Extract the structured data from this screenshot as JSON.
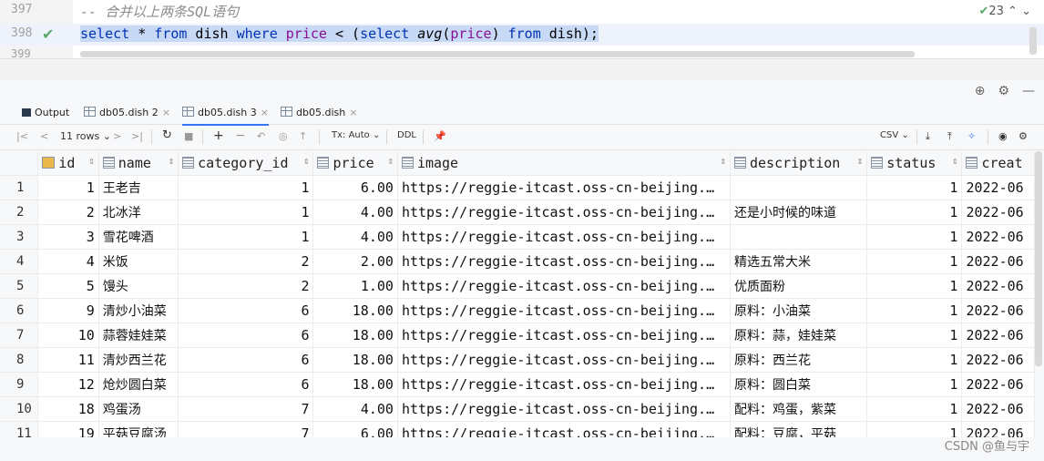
{
  "editor": {
    "line1_num": "397",
    "line1_comment": "-- 合并以上两条SQL语句",
    "line2_num": "398",
    "line3_num": "399",
    "inspection_count": "23",
    "sql": {
      "t1": "select",
      "t2": " * ",
      "t3": "from",
      "t4": " dish ",
      "t5": "where",
      "t6": " ",
      "t7": "price",
      "t8": " < (",
      "t9": "select",
      "t10": " ",
      "t11": "avg",
      "t12": "(",
      "t13": "price",
      "t14": ") ",
      "t15": "from",
      "t16": " dish);"
    }
  },
  "tabs": [
    {
      "label": "Output"
    },
    {
      "label": "db05.dish 2"
    },
    {
      "label": "db05.dish 3"
    },
    {
      "label": "db05.dish"
    }
  ],
  "toolbar": {
    "rows": "11 rows",
    "tx": "Tx: Auto",
    "ddl": "DDL",
    "csv": "CSV"
  },
  "columns": [
    "id",
    "name",
    "category_id",
    "price",
    "image",
    "description",
    "status",
    "creat"
  ],
  "rows": [
    {
      "n": "1",
      "id": "1",
      "name": "王老吉",
      "cat": "1",
      "price": "6.00",
      "image": "https://reggie-itcast.oss-cn-beijing.…",
      "desc": "",
      "status": "1",
      "creat": "2022-06"
    },
    {
      "n": "2",
      "id": "2",
      "name": "北冰洋",
      "cat": "1",
      "price": "4.00",
      "image": "https://reggie-itcast.oss-cn-beijing.…",
      "desc": "还是小时候的味道",
      "status": "1",
      "creat": "2022-06"
    },
    {
      "n": "3",
      "id": "3",
      "name": "雪花啤酒",
      "cat": "1",
      "price": "4.00",
      "image": "https://reggie-itcast.oss-cn-beijing.…",
      "desc": "",
      "status": "1",
      "creat": "2022-06"
    },
    {
      "n": "4",
      "id": "4",
      "name": "米饭",
      "cat": "2",
      "price": "2.00",
      "image": "https://reggie-itcast.oss-cn-beijing.…",
      "desc": "精选五常大米",
      "status": "1",
      "creat": "2022-06"
    },
    {
      "n": "5",
      "id": "5",
      "name": "馒头",
      "cat": "2",
      "price": "1.00",
      "image": "https://reggie-itcast.oss-cn-beijing.…",
      "desc": "优质面粉",
      "status": "1",
      "creat": "2022-06"
    },
    {
      "n": "6",
      "id": "9",
      "name": "清炒小油菜",
      "cat": "6",
      "price": "18.00",
      "image": "https://reggie-itcast.oss-cn-beijing.…",
      "desc": "原料：小油菜",
      "status": "1",
      "creat": "2022-06"
    },
    {
      "n": "7",
      "id": "10",
      "name": "蒜蓉娃娃菜",
      "cat": "6",
      "price": "18.00",
      "image": "https://reggie-itcast.oss-cn-beijing.…",
      "desc": "原料：蒜，娃娃菜",
      "status": "1",
      "creat": "2022-06"
    },
    {
      "n": "8",
      "id": "11",
      "name": "清炒西兰花",
      "cat": "6",
      "price": "18.00",
      "image": "https://reggie-itcast.oss-cn-beijing.…",
      "desc": "原料：西兰花",
      "status": "1",
      "creat": "2022-06"
    },
    {
      "n": "9",
      "id": "12",
      "name": "炝炒圆白菜",
      "cat": "6",
      "price": "18.00",
      "image": "https://reggie-itcast.oss-cn-beijing.…",
      "desc": "原料：圆白菜",
      "status": "1",
      "creat": "2022-06"
    },
    {
      "n": "10",
      "id": "18",
      "name": "鸡蛋汤",
      "cat": "7",
      "price": "4.00",
      "image": "https://reggie-itcast.oss-cn-beijing.…",
      "desc": "配料：鸡蛋，紫菜",
      "status": "1",
      "creat": "2022-06"
    },
    {
      "n": "11",
      "id": "19",
      "name": "平菇豆腐汤",
      "cat": "7",
      "price": "6.00",
      "image": "https://reggie-itcast.oss-cn-beijing.…",
      "desc": "配料：豆腐，平菇",
      "status": "1",
      "creat": "2022-06"
    }
  ],
  "watermark": "CSDN @鱼与宇"
}
